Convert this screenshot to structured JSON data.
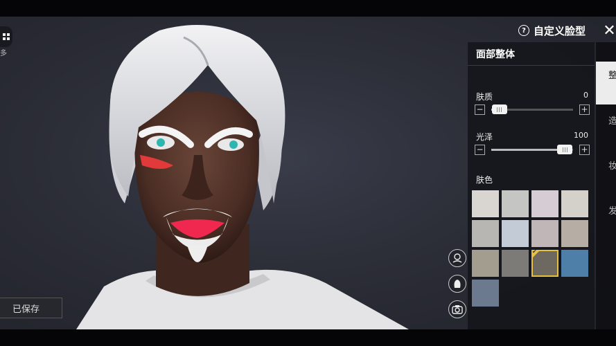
{
  "header": {
    "title": "自定义脸型",
    "help_glyph": "?",
    "close_glyph": "✕"
  },
  "left": {
    "menu_text": "多",
    "saved_label": "已保存"
  },
  "panel": {
    "section_title": "面部整体",
    "sliders": [
      {
        "label": "肤质",
        "value": "0",
        "fraction": 0.1
      },
      {
        "label": "光泽",
        "value": "100",
        "fraction": 0.9
      }
    ],
    "minus_glyph": "−",
    "plus_glyph": "+",
    "skin_label": "肤色",
    "skin_colors": [
      "#d9d6d2",
      "#c5c6c4",
      "#d6ccd4",
      "#d3d1c9",
      "#b8b6b3",
      "#c3cbd7",
      "#c1b6b7",
      "#b6aea4",
      "#a29d8e",
      "#7d7b77",
      "#6d6860",
      "#4e7fa8",
      "#6b7a8f"
    ],
    "selected_index": 10,
    "check_glyph": "✔"
  },
  "tabs": [
    {
      "label": "整体",
      "active": true
    },
    {
      "label": "造型",
      "active": false
    },
    {
      "label": "妆容",
      "active": false
    },
    {
      "label": "发型",
      "active": false
    }
  ],
  "side_buttons": [
    {
      "icon": "face-rotate-icon"
    },
    {
      "icon": "head-outline-icon"
    },
    {
      "icon": "camera-icon"
    }
  ]
}
